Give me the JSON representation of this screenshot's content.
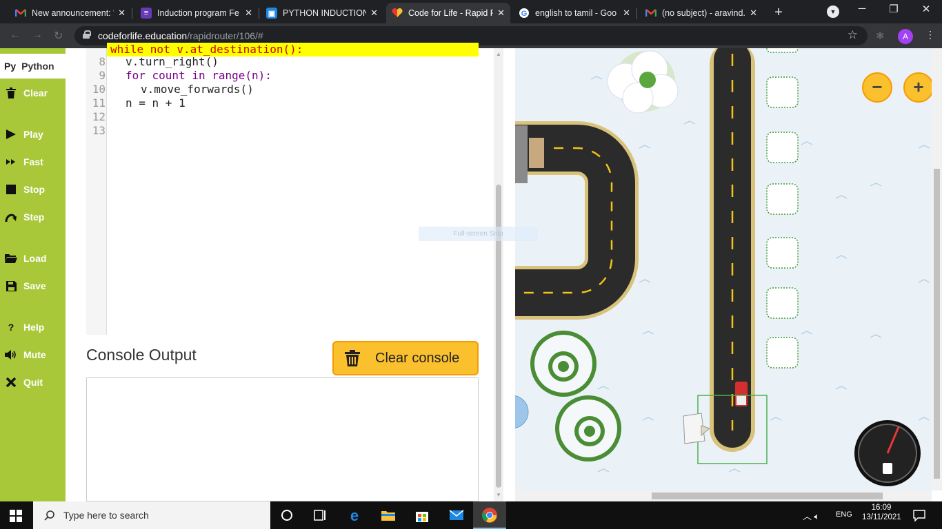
{
  "browser": {
    "tabs": [
      {
        "title": "New announcement: \"",
        "icon": "gmail-icon",
        "active": false
      },
      {
        "title": "Induction program Fe",
        "icon": "forms-icon",
        "active": false
      },
      {
        "title": "PYTHON INDUCTION",
        "icon": "classroom-icon",
        "active": false
      },
      {
        "title": "Code for Life - Rapid R",
        "icon": "codeforlife-icon",
        "active": true
      },
      {
        "title": "english to tamil - Goo",
        "icon": "google-icon",
        "active": false
      },
      {
        "title": "(no subject) - aravind.",
        "icon": "gmail-icon",
        "active": false
      }
    ],
    "new_tab": "+",
    "url_host": "codeforlife.education",
    "url_path": "/rapidrouter/106/#",
    "profile_initial": "A"
  },
  "sidebar": {
    "language_tab": {
      "icon_text": "Py",
      "label": "Python"
    },
    "items": [
      {
        "label": "Clear",
        "icon": "trash-icon"
      },
      {
        "label": "Play",
        "icon": "play-icon"
      },
      {
        "label": "Fast",
        "icon": "fast-forward-icon"
      },
      {
        "label": "Stop",
        "icon": "stop-icon"
      },
      {
        "label": "Step",
        "icon": "step-icon"
      },
      {
        "label": "Load",
        "icon": "folder-icon"
      },
      {
        "label": "Save",
        "icon": "floppy-icon"
      },
      {
        "label": "Help",
        "icon": "question-icon"
      },
      {
        "label": "Mute",
        "icon": "speaker-icon"
      },
      {
        "label": "Quit",
        "icon": "close-icon"
      }
    ]
  },
  "editor": {
    "lines": [
      {
        "num": "8",
        "code": "v.turn_right()"
      },
      {
        "num": "9",
        "code": "for count in range(n):"
      },
      {
        "num": "10",
        "code": "v.move_forwards()"
      },
      {
        "num": "11",
        "code": "n = n + 1"
      },
      {
        "num": "12",
        "code": ""
      },
      {
        "num": "13",
        "code": ""
      }
    ],
    "highlighted_line": "while not v.at_destination():",
    "highlight_color": "#ffff00"
  },
  "console": {
    "title": "Console Output",
    "clear_label": "Clear console",
    "output": ""
  },
  "game": {
    "zoom_out": "−",
    "zoom_in": "+",
    "snip_label": "Full-screen Snip",
    "accent": "#fbc02d"
  },
  "taskbar": {
    "search_placeholder": "Type here to search",
    "language": "ENG",
    "time": "16:09",
    "date": "13/11/2021"
  }
}
